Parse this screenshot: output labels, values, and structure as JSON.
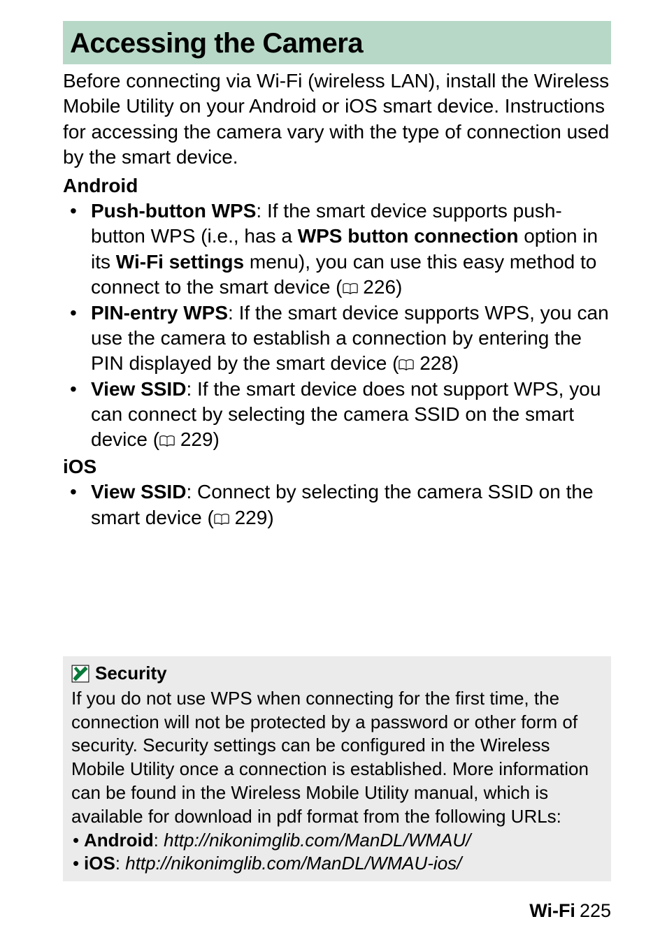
{
  "title": "Accessing the Camera",
  "intro": "Before connecting via Wi-Fi (wireless LAN), install the Wireless Mobile Utility on your Android or iOS smart device.  Instructions for accessing the camera vary with the type of connection used by the smart device.",
  "android": {
    "heading": "Android",
    "items": [
      {
        "label": "Push-button WPS",
        "pre": ": If the smart device supports push-button WPS (i.e., has a ",
        "bold1": "WPS button connection",
        "mid": " option in its ",
        "bold2": "Wi-Fi settings",
        "post": " menu), you can use this easy method to connect to the smart device (",
        "page": " 226)"
      },
      {
        "label": "PIN-entry WPS",
        "text1": ": If the smart device supports WPS, you can use the camera to establish a connection by entering the PIN displayed by the smart device (",
        "page": " 228)"
      },
      {
        "label": " View SSID",
        "text1": ": If the smart device does not support WPS, you can connect by selecting the camera SSID on the smart device (",
        "page": " 229)"
      }
    ]
  },
  "ios": {
    "heading": "iOS",
    "items": [
      {
        "label": "View SSID",
        "text1": ": Connect by selecting the camera SSID on the smart device (",
        "page": " 229)"
      }
    ]
  },
  "note": {
    "title": "Security",
    "body": "If you do not use WPS when connecting for the first time, the connection will not be protected by a password or other form of security.  Security settings can be configured in the Wireless Mobile Utility once a connection is established.  More information can be found in the Wireless Mobile Utility manual, which is available for download in pdf format from the following URLs:",
    "links": [
      {
        "label": "Android",
        "sep": ": ",
        "url": "http://nikonimglib.com/ManDL/WMAU/"
      },
      {
        "label": "iOS",
        "sep": ": ",
        "url": "http://nikonimglib.com/ManDL/WMAU-ios/"
      }
    ]
  },
  "footer": {
    "section": "Wi-Fi",
    "page": "225"
  }
}
